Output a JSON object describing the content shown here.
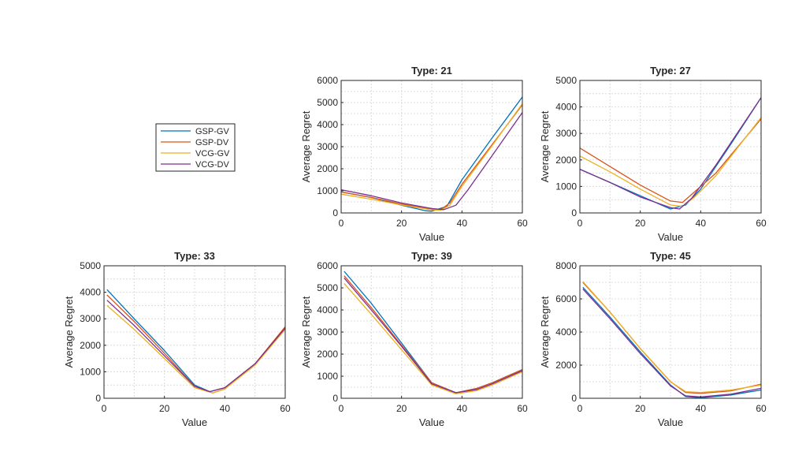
{
  "legend": [
    {
      "label": "GSP-GV",
      "color": "#0072BD"
    },
    {
      "label": "GSP-DV",
      "color": "#D95319"
    },
    {
      "label": "VCG-GV",
      "color": "#EDB120"
    },
    {
      "label": "VCG-DV",
      "color": "#7E2F8E"
    }
  ],
  "chart_data": [
    {
      "type": "line",
      "title": "Type: 21",
      "xlabel": "Value",
      "ylabel": "Average Regret",
      "xlim": [
        0,
        60
      ],
      "ylim": [
        0,
        6000
      ],
      "xticks": [
        0,
        20,
        40,
        60
      ],
      "yticks": [
        0,
        1000,
        2000,
        3000,
        4000,
        5000,
        6000
      ],
      "grid": true,
      "series": [
        {
          "name": "GSP-GV",
          "x": [
            0,
            10,
            20,
            28,
            30,
            35,
            40,
            50,
            60
          ],
          "y": [
            950,
            700,
            350,
            100,
            80,
            300,
            1500,
            3400,
            5250
          ]
        },
        {
          "name": "GSP-DV",
          "x": [
            0,
            10,
            20,
            30,
            33,
            36,
            40,
            50,
            60
          ],
          "y": [
            950,
            700,
            400,
            160,
            150,
            450,
            1300,
            3100,
            4900
          ]
        },
        {
          "name": "VCG-GV",
          "x": [
            0,
            10,
            20,
            30,
            33,
            36,
            40,
            50,
            60
          ],
          "y": [
            850,
            620,
            360,
            140,
            120,
            350,
            1200,
            3050,
            4950
          ]
        },
        {
          "name": "VCG-DV",
          "x": [
            0,
            10,
            20,
            30,
            34,
            38,
            42,
            50,
            60
          ],
          "y": [
            1050,
            780,
            450,
            200,
            150,
            350,
            1050,
            2600,
            4550
          ]
        }
      ]
    },
    {
      "type": "line",
      "title": "Type: 27",
      "xlabel": "Value",
      "ylabel": "Average Regret",
      "xlim": [
        0,
        60
      ],
      "ylim": [
        0,
        5000
      ],
      "xticks": [
        0,
        20,
        40,
        60
      ],
      "yticks": [
        0,
        1000,
        2000,
        3000,
        4000,
        5000
      ],
      "grid": true,
      "series": [
        {
          "name": "GSP-GV",
          "x": [
            0,
            10,
            20,
            30,
            35,
            40,
            50,
            60
          ],
          "y": [
            1650,
            1150,
            650,
            150,
            300,
            900,
            2600,
            4350
          ]
        },
        {
          "name": "GSP-DV",
          "x": [
            0,
            10,
            20,
            30,
            34,
            38,
            45,
            60
          ],
          "y": [
            2450,
            1750,
            1050,
            450,
            400,
            800,
            1500,
            3550
          ]
        },
        {
          "name": "VCG-GV",
          "x": [
            0,
            10,
            20,
            30,
            34,
            38,
            45,
            60
          ],
          "y": [
            2150,
            1550,
            900,
            300,
            250,
            600,
            1400,
            3600
          ]
        },
        {
          "name": "VCG-DV",
          "x": [
            0,
            10,
            20,
            30,
            33,
            37,
            45,
            60
          ],
          "y": [
            1650,
            1150,
            600,
            200,
            150,
            550,
            1800,
            4350
          ]
        }
      ]
    },
    {
      "type": "line",
      "title": "Type: 33",
      "xlabel": "Value",
      "ylabel": "Average Regret",
      "xlim": [
        0,
        60
      ],
      "ylim": [
        0,
        5000
      ],
      "xticks": [
        0,
        20,
        40,
        60
      ],
      "yticks": [
        0,
        1000,
        2000,
        3000,
        4000,
        5000
      ],
      "grid": true,
      "series": [
        {
          "name": "GSP-GV",
          "x": [
            1,
            10,
            20,
            30,
            35,
            40,
            50,
            60
          ],
          "y": [
            4100,
            3000,
            1800,
            500,
            250,
            400,
            1300,
            2600
          ]
        },
        {
          "name": "GSP-DV",
          "x": [
            1,
            10,
            20,
            30,
            36,
            40,
            50,
            60
          ],
          "y": [
            3900,
            2900,
            1700,
            450,
            200,
            350,
            1300,
            2700
          ]
        },
        {
          "name": "VCG-GV",
          "x": [
            1,
            10,
            20,
            30,
            36,
            40,
            50,
            60
          ],
          "y": [
            3500,
            2600,
            1500,
            400,
            200,
            350,
            1250,
            2600
          ]
        },
        {
          "name": "VCG-DV",
          "x": [
            1,
            10,
            20,
            30,
            35,
            40,
            50,
            60
          ],
          "y": [
            3700,
            2750,
            1600,
            450,
            250,
            400,
            1300,
            2650
          ]
        }
      ]
    },
    {
      "type": "line",
      "title": "Type: 39",
      "xlabel": "Value",
      "ylabel": "Average Regret",
      "xlim": [
        0,
        60
      ],
      "ylim": [
        0,
        6000
      ],
      "xticks": [
        0,
        20,
        40,
        60
      ],
      "yticks": [
        0,
        1000,
        2000,
        3000,
        4000,
        5000,
        6000
      ],
      "grid": true,
      "series": [
        {
          "name": "GSP-GV",
          "x": [
            1,
            10,
            20,
            30,
            38,
            45,
            50,
            60
          ],
          "y": [
            5750,
            4300,
            2500,
            700,
            250,
            450,
            700,
            1300
          ]
        },
        {
          "name": "GSP-DV",
          "x": [
            1,
            10,
            20,
            30,
            38,
            45,
            50,
            60
          ],
          "y": [
            5550,
            4100,
            2400,
            700,
            250,
            450,
            700,
            1300
          ]
        },
        {
          "name": "VCG-GV",
          "x": [
            1,
            10,
            20,
            30,
            38,
            45,
            50,
            60
          ],
          "y": [
            5200,
            3800,
            2200,
            600,
            200,
            350,
            600,
            1200
          ]
        },
        {
          "name": "VCG-DV",
          "x": [
            1,
            10,
            20,
            30,
            38,
            45,
            50,
            60
          ],
          "y": [
            5450,
            4000,
            2350,
            650,
            250,
            400,
            650,
            1250
          ]
        }
      ]
    },
    {
      "type": "line",
      "title": "Type: 45",
      "xlabel": "Value",
      "ylabel": "Average Regret",
      "xlim": [
        0,
        60
      ],
      "ylim": [
        0,
        8000
      ],
      "xticks": [
        0,
        20,
        40,
        60
      ],
      "yticks": [
        0,
        2000,
        4000,
        6000,
        8000
      ],
      "grid": true,
      "series": [
        {
          "name": "GSP-GV",
          "x": [
            1,
            10,
            20,
            30,
            35,
            40,
            50,
            60
          ],
          "y": [
            6700,
            4900,
            2800,
            800,
            100,
            30,
            200,
            500
          ]
        },
        {
          "name": "GSP-DV",
          "x": [
            1,
            10,
            20,
            30,
            35,
            40,
            50,
            60
          ],
          "y": [
            7000,
            5200,
            3000,
            1000,
            350,
            300,
            450,
            850
          ]
        },
        {
          "name": "VCG-GV",
          "x": [
            1,
            10,
            20,
            30,
            35,
            40,
            50,
            60
          ],
          "y": [
            7050,
            5200,
            3000,
            1000,
            400,
            350,
            500,
            800
          ]
        },
        {
          "name": "VCG-DV",
          "x": [
            1,
            10,
            20,
            30,
            35,
            40,
            50,
            60
          ],
          "y": [
            6600,
            4800,
            2700,
            750,
            150,
            80,
            250,
            600
          ]
        }
      ]
    }
  ]
}
